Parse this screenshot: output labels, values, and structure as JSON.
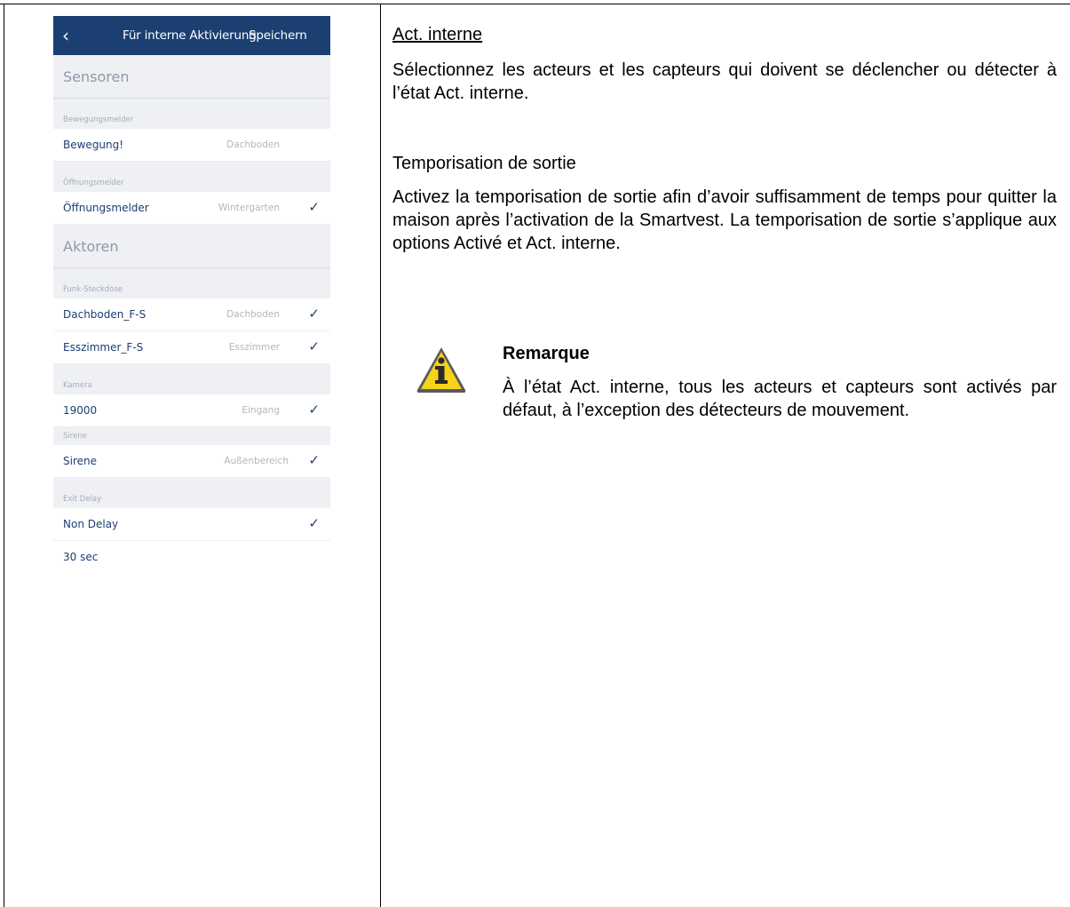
{
  "phone": {
    "header": {
      "title": "Für interne Aktivierung",
      "save_label": "Speichern"
    },
    "sections": {
      "sensors": "Sensoren",
      "actuators": "Aktoren"
    },
    "groups": {
      "motion": "Bewegungsmelder",
      "opening": "Öffnungsmelder",
      "socket": "Funk-Steckdose",
      "camera": "Kamera",
      "siren": "Sirene",
      "exit_delay": "Exit Delay"
    },
    "rows": [
      {
        "name": "Bewegung!",
        "room": "Dachboden",
        "checked": false
      },
      {
        "name": "Öffnungsmelder",
        "room": "Wintergarten",
        "checked": true
      },
      {
        "name": "Dachboden_F-S",
        "room": "Dachboden",
        "checked": true
      },
      {
        "name": "Esszimmer_F-S",
        "room": "Esszimmer",
        "checked": true
      },
      {
        "name": "19000",
        "room": "Eingang",
        "checked": true
      },
      {
        "name": "Sirene",
        "room": "Außenbereich",
        "checked": true
      },
      {
        "name": "Non Delay",
        "room": "",
        "checked": true
      },
      {
        "name": "30 sec",
        "room": "",
        "checked": false
      }
    ],
    "check_glyph": "✓",
    "accent_color": "#1c3f72"
  },
  "doc": {
    "heading": "Act. interne",
    "para1": "Sélectionnez les acteurs et les capteurs qui doivent se déclencher ou détecter à l’état Act. interne.",
    "subheading": "Temporisation de sortie",
    "para2": "Activez la temporisation de sortie afin d’avoir suffisamment de temps pour quitter la maison après l’activation de la Smartvest. La temporisation de sortie s’applique aux options Activé et Act. interne.",
    "note_title": "Remarque",
    "note_text": "À l’état Act. interne, tous les acteurs et capteurs sont activés par défaut, à l’exception des détecteurs de mouvement.",
    "note_icon": "warning-info-icon"
  }
}
